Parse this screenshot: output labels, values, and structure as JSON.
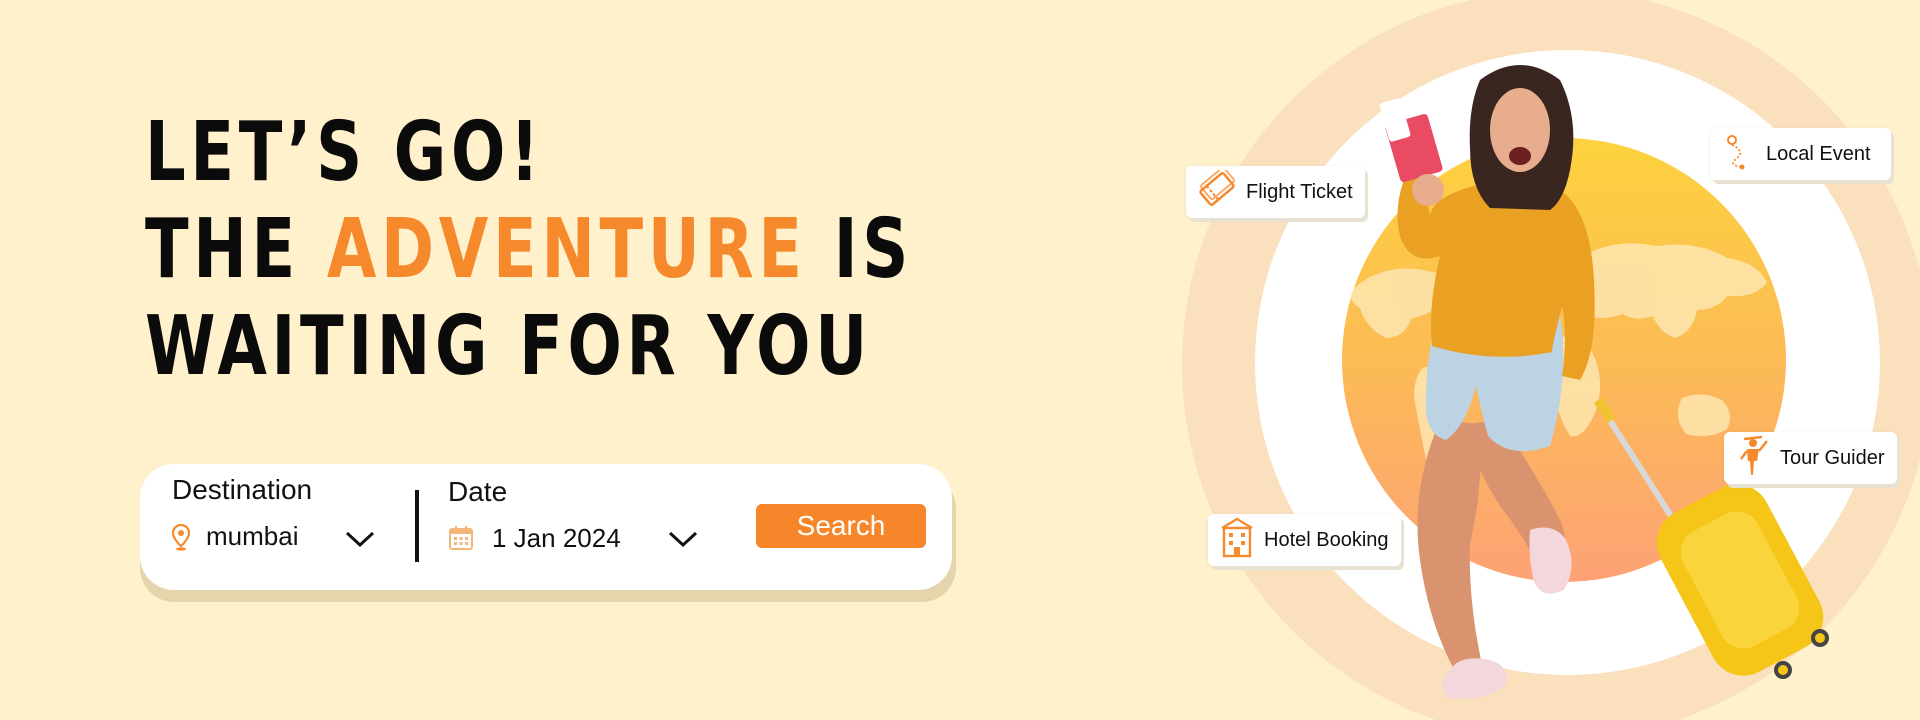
{
  "hero": {
    "line1": "LET’S GO!",
    "line2_pre": "THE ",
    "line2_accent": "ADVENTURE",
    "line2_post": " IS",
    "line3": "WAITING FOR YOU"
  },
  "search": {
    "destination_label": "Destination",
    "destination_value": "mumbai",
    "date_label": "Date",
    "date_value": "1 Jan 2024",
    "button_label": "Search"
  },
  "chips": {
    "flight": "Flight Ticket",
    "local_event": "Local Event",
    "tour_guider": "Tour Guider",
    "hotel": "Hotel Booking"
  },
  "colors": {
    "background": "#fef1cc",
    "accent": "#f5892c",
    "button": "#f7862a"
  },
  "icons": {
    "destination": "location-pin-icon",
    "date": "calendar-icon",
    "dropdown": "chevron-down-icon",
    "flight": "flight-ticket-icon",
    "local_event": "route-pin-icon",
    "tour_guider": "tour-guide-icon",
    "hotel": "hotel-building-icon"
  }
}
